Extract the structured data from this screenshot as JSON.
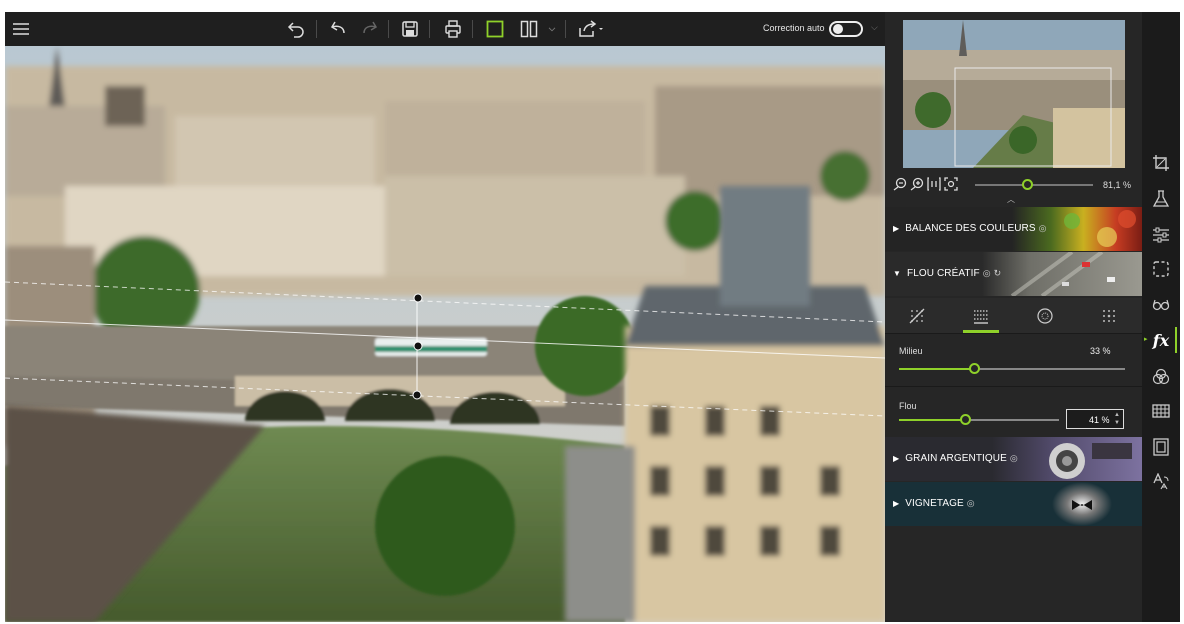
{
  "toolbar": {
    "auto_correction_label": "Correction auto",
    "auto_correction_on": false,
    "icons": [
      "menu-icon",
      "undo-all-icon",
      "undo-icon",
      "redo-icon",
      "save-icon",
      "print-icon",
      "single-view-icon",
      "split-view-icon",
      "share-icon"
    ]
  },
  "navigator": {
    "zoom_value": "81,1 %",
    "zoom_level": 0.4
  },
  "sections": {
    "color_balance": "BALANCE DES COULEURS",
    "creative_blur": "FLOU CRÉATIF",
    "film_grain": "GRAIN ARGENTIQUE",
    "vignetting": "VIGNETAGE"
  },
  "blur_tabs": [
    "no-blur-icon",
    "linear-blur-icon",
    "radial-blur-icon",
    "grid-blur-icon"
  ],
  "sliders": {
    "middle": {
      "label": "Milieu",
      "value": "33 %",
      "level": 0.33
    },
    "blur": {
      "label": "Flou",
      "value": "41 %",
      "level": 0.41
    }
  },
  "sidebar_tools": [
    "crop-icon",
    "flask-icon",
    "adjustments-icon",
    "selection-icon",
    "glasses-icon",
    "fx-icon",
    "color-wheel-icon",
    "grid-icon",
    "frame-icon",
    "text-icon"
  ],
  "sidebar_fx_label": "fx",
  "colors": {
    "accent": "#8fd12a",
    "panel_bg": "#262626",
    "toolbar_bg": "#1f1f1f"
  }
}
